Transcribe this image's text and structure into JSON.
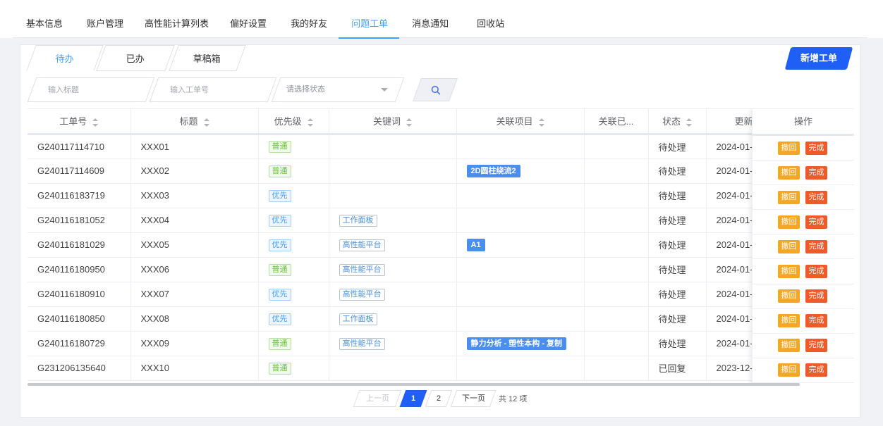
{
  "top_tabs": [
    "基本信息",
    "账户管理",
    "高性能计算列表",
    "偏好设置",
    "我的好友",
    "问题工单",
    "消息通知",
    "回收站"
  ],
  "sub_tabs": [
    "待办",
    "已办",
    "草稿箱"
  ],
  "new_button": "新增工单",
  "filters": {
    "title_placeholder": "输入标题",
    "id_placeholder": "输入工单号",
    "status_placeholder": "请选择状态"
  },
  "columns": [
    "工单号",
    "标题",
    "优先级",
    "关键词",
    "关联项目",
    "关联已...",
    "状态",
    "更新",
    "操作"
  ],
  "rows": [
    {
      "id": "G240117114710",
      "title": "XXX01",
      "priority": "普通",
      "keyword": "",
      "project": "",
      "status": "待处理",
      "updated": "2024-01-"
    },
    {
      "id": "G240117114609",
      "title": "XXX02",
      "priority": "普通",
      "keyword": "",
      "project": "2D圆柱绕流2",
      "status": "待处理",
      "updated": "2024-01-"
    },
    {
      "id": "G240116183719",
      "title": "XXX03",
      "priority": "优先",
      "keyword": "",
      "project": "",
      "status": "待处理",
      "updated": "2024-01-"
    },
    {
      "id": "G240116181052",
      "title": "XXX04",
      "priority": "优先",
      "keyword": "工作面板",
      "project": "",
      "status": "待处理",
      "updated": "2024-01-"
    },
    {
      "id": "G240116181029",
      "title": "XXX05",
      "priority": "优先",
      "keyword": "高性能平台",
      "project": "A1",
      "status": "待处理",
      "updated": "2024-01-"
    },
    {
      "id": "G240116180950",
      "title": "XXX06",
      "priority": "普通",
      "keyword": "高性能平台",
      "project": "",
      "status": "待处理",
      "updated": "2024-01-"
    },
    {
      "id": "G240116180910",
      "title": "XXX07",
      "priority": "优先",
      "keyword": "高性能平台",
      "project": "",
      "status": "待处理",
      "updated": "2024-01-"
    },
    {
      "id": "G240116180850",
      "title": "XXX08",
      "priority": "优先",
      "keyword": "工作面板",
      "project": "",
      "status": "待处理",
      "updated": "2024-01-"
    },
    {
      "id": "G240116180729",
      "title": "XXX09",
      "priority": "普通",
      "keyword": "高性能平台",
      "project": "静力分析 - 塑性本构 - 复制",
      "status": "待处理",
      "updated": "2024-01-"
    },
    {
      "id": "G231206135640",
      "title": "XXX10",
      "priority": "普通",
      "keyword": "",
      "project": "",
      "status": "已回复",
      "updated": "2023-12-"
    }
  ],
  "row_actions": {
    "recall": "撤回",
    "done": "完成"
  },
  "pagination": {
    "prev": "上一页",
    "pages": [
      "1",
      "2"
    ],
    "current": "1",
    "next": "下一页",
    "total": "共 12 项"
  },
  "colors": {
    "accent": "#409eff",
    "primary_button": "#1f5ff5",
    "recall": "#f5a623",
    "done": "#f05a28"
  },
  "icons": {
    "search": "search-icon",
    "select_caret": "chevron-down-icon"
  }
}
